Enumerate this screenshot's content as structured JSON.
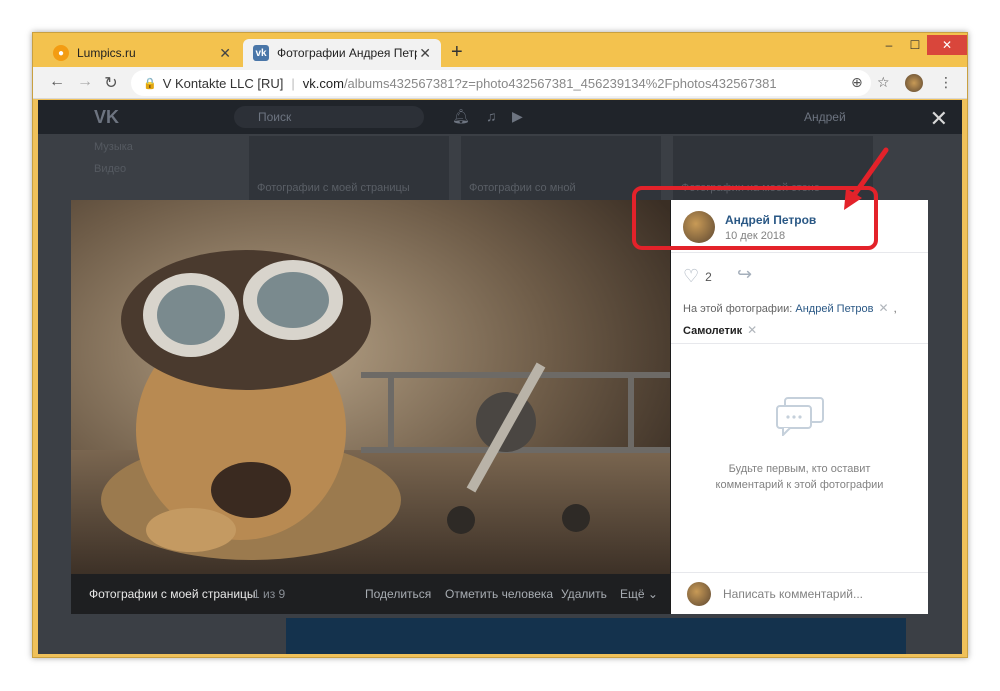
{
  "browser": {
    "tabs": [
      {
        "title": "Lumpics.ru",
        "close": "✕"
      },
      {
        "title": "Фотографии Андрея Петрова –",
        "close": "✕"
      }
    ],
    "new_tab": "+",
    "controls": {
      "minimize": "–",
      "maximize": "☐",
      "close": "✕"
    },
    "address": {
      "org": "V Kontakte LLC [RU]",
      "host": "vk.com",
      "path": "/albums432567381?z=photo432567381_456239134%2Fphotos432567381"
    }
  },
  "vk": {
    "logo": "VK",
    "search_placeholder": "Поиск",
    "user_name": "Андрей",
    "sidebar": [
      "Музыка",
      "Видео"
    ],
    "bg_tiles": [
      "Фотографии с моей страницы",
      "Фотографии со мной",
      "Фотографии на моей стене"
    ],
    "close_viewer": "✕"
  },
  "viewer": {
    "album": "Фотографии с моей страницы",
    "counter": "1 из 9",
    "actions": [
      "Поделиться",
      "Отметить человека",
      "Удалить",
      "Ещё ⌄"
    ],
    "author": "Андрей Петров",
    "date": "10 дек 2018",
    "likes": "2",
    "tags_label": "На этой фотографии:",
    "tag1": "Андрей Петров",
    "tag2": "Самолетик",
    "tag_remove": "✕",
    "comma": ",",
    "empty_line1": "Будьте первым, кто оставит",
    "empty_line2": "комментарий к этой фотографии",
    "comment_placeholder": "Написать комментарий..."
  },
  "colors": {
    "highlight": "#e3222a",
    "link": "#2a5885",
    "titlebar": "#f3c24e"
  }
}
